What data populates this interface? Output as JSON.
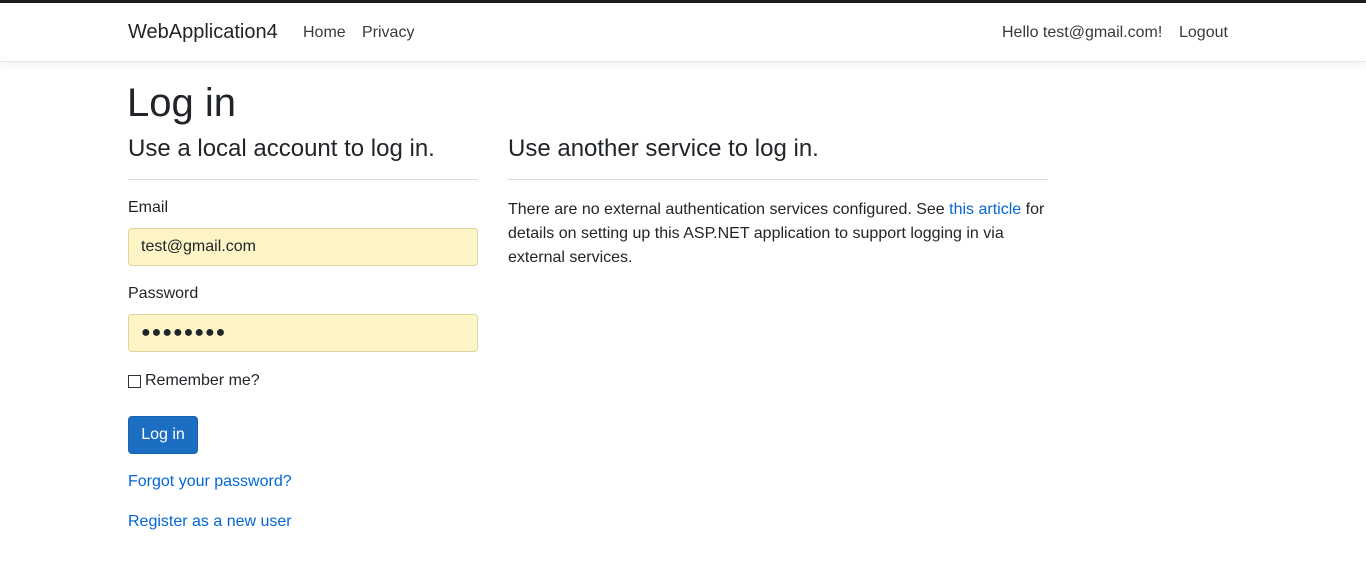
{
  "nav": {
    "brand": "WebApplication4",
    "home": "Home",
    "privacy": "Privacy",
    "greeting": "Hello test@gmail.com!",
    "logout": "Logout"
  },
  "page": {
    "title": "Log in"
  },
  "local": {
    "heading": "Use a local account to log in.",
    "email_label": "Email",
    "email_value": "test@gmail.com",
    "password_label": "Password",
    "password_value": "●●●●●●●●",
    "remember_label": "Remember me?",
    "remember_checked": false,
    "login_button": "Log in",
    "forgot_link": "Forgot your password?",
    "register_link": "Register as a new user"
  },
  "external": {
    "heading": "Use another service to log in.",
    "text_before": "There are no external authentication services configured. See ",
    "link_text": "this article",
    "text_after": " for details on setting up this ASP.NET application to support logging in via external services."
  },
  "colors": {
    "primary": "#1b6ec2",
    "link": "#0366d6",
    "autofill": "#fef5c6"
  }
}
